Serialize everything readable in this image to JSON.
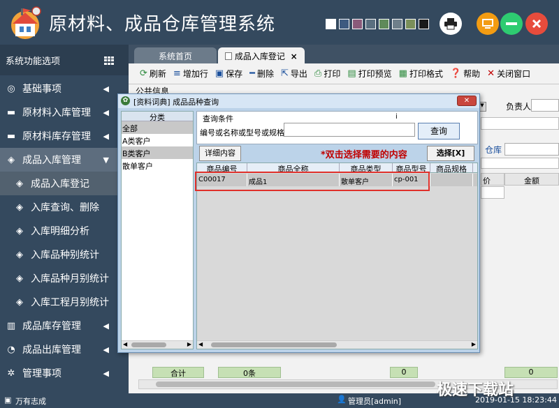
{
  "app": {
    "title": "原材料、成品仓库管理系统"
  },
  "theme_swatches": [
    "#ffffff",
    "#3d5a80",
    "#8a5a7a",
    "#5a6f80",
    "#5f8a5a",
    "#6f7f8a",
    "#7a8f5a",
    "#1a1a1a"
  ],
  "header_buttons": [
    {
      "icon": "printer-icon",
      "color": "#ffffff"
    },
    {
      "icon": "monitor-icon",
      "color": "#f39c12"
    },
    {
      "icon": "minimize-icon",
      "color": "#2ecc71"
    },
    {
      "icon": "close-icon",
      "color": "#e74c3c"
    }
  ],
  "sidebar": {
    "title": "系统功能选项",
    "items": [
      {
        "label": "基础事项",
        "icon": "◎"
      },
      {
        "label": "原材料入库管理",
        "icon": "▬"
      },
      {
        "label": "原材料库存管理",
        "icon": "▬"
      },
      {
        "label": "成品入库管理",
        "icon": "◈"
      },
      {
        "label": "成品入库登记",
        "icon": "◈"
      },
      {
        "label": "入库查询、删除",
        "icon": "◈"
      },
      {
        "label": "入库明细分析",
        "icon": "◈"
      },
      {
        "label": "入库品种别统计",
        "icon": "◈"
      },
      {
        "label": "入库品种月别统计",
        "icon": "◈"
      },
      {
        "label": "入库工程月别统计",
        "icon": "◈"
      },
      {
        "label": "成品库存管理",
        "icon": "▥"
      },
      {
        "label": "成品出库管理",
        "icon": "◔"
      },
      {
        "label": "管理事项",
        "icon": "✲"
      }
    ]
  },
  "tabs": {
    "home": "系统首页",
    "entry": "成品入库登记",
    "entry_close": "×"
  },
  "toolbar": {
    "refresh": "刷新",
    "add_row": "增加行",
    "save": "保存",
    "delete": "删除",
    "export": "导出",
    "print": "打印",
    "print_preview": "打印预览",
    "print_format": "打印格式",
    "help": "帮助",
    "close_window": "关闭窗口"
  },
  "form": {
    "public_info": "公共信息",
    "responsible_label": "负责人",
    "warehouse_label": "仓库",
    "price_header": "价",
    "amount_header": "金额"
  },
  "summary": {
    "label": "合计",
    "count": "0条",
    "qty": "0",
    "amount": "0"
  },
  "dialog": {
    "title": "[资料词典] 成品品种查询",
    "close": "✕",
    "category_header": "分类",
    "categories": [
      "全部",
      "A类客户",
      "B类客户",
      "散单客户"
    ],
    "query_legend": "查询条件",
    "query_i": "i",
    "query_label": "编号或名称或型号或规格",
    "query_button": "查询",
    "detail_button": "详细内容",
    "hint": "*双击选择需要的内容",
    "select_button": "选择[X]",
    "columns": [
      "商品编号",
      "商品全称",
      "商品类型",
      "商品型号",
      "商品规格"
    ],
    "rows": [
      [
        "C00017",
        "成品1",
        "散单客户",
        "cp-001",
        ""
      ]
    ]
  },
  "status": {
    "company": "万有志成",
    "user": "管理员[admin]",
    "datetime": "2019-01-15 18:23:44"
  },
  "watermark": "极速下载站"
}
